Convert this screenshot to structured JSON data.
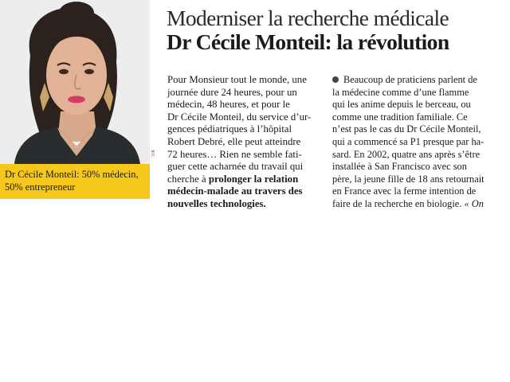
{
  "headline": {
    "kicker": "Moderniser la recherche médicale",
    "title": "Dr Cécile Monteil: la révolution"
  },
  "photo": {
    "credit": "DR"
  },
  "caption": {
    "line1": "Dr Cécile Monteil: 50% médecin,",
    "line2": "50% entrepreneur"
  },
  "column1": {
    "lines": [
      "Pour Monsieur tout le monde, une",
      "journée dure 24 heures, pour un",
      "médecin, 48 heures, et pour le",
      "Dr Cécile Monteil, du service d’ur-",
      "gences pédiatriques à l’hôpital",
      "Robert Debré, elle peut atteindre",
      "72 heures… Rien ne semble fati-",
      "guer cette acharnée du travail qui"
    ],
    "line9_start": "cherche à ",
    "line9_bold": "prolonger la relation",
    "line10_bold": "médecin-malade au travers des",
    "line11_bold": "nouvelles technologies."
  },
  "column2": {
    "line1": "Beaucoup de praticiens parlent de",
    "lines": [
      "la médecine comme d’une flamme",
      "qui les anime depuis le berceau, ou",
      "comme une tradition familiale. Ce",
      "n’est pas le cas du Dr Cécile Monteil,",
      "qui a commencé sa P1 presque par ha-",
      "sard. En 2002, quatre ans après s’être",
      "installée à San Francisco avec son",
      "père, la jeune fille de 18 ans retournait",
      "en France avec la ferme intention de"
    ],
    "last_line_start": "faire de la recherche en biologie. ",
    "last_line_italic": "« On"
  }
}
